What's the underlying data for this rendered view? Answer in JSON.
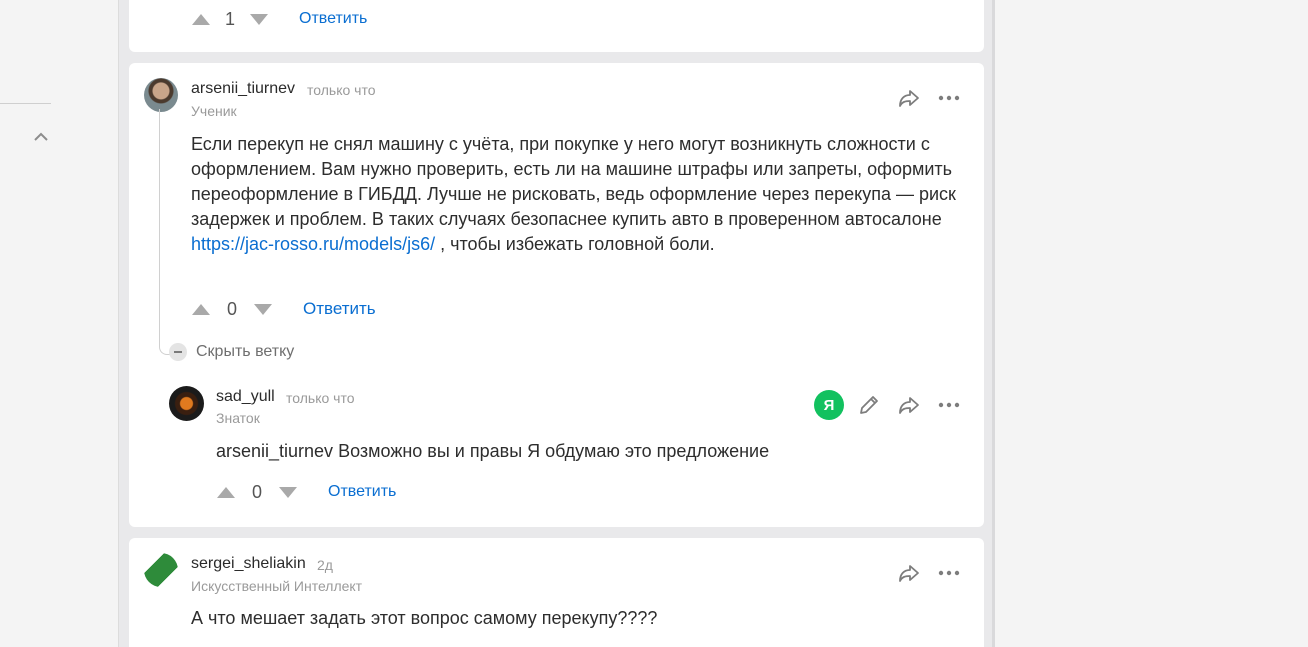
{
  "prev_comment": {
    "vote_count": "1",
    "reply_label": "Ответить"
  },
  "comment_main": {
    "username": "arsenii_tiurnev",
    "time": "только что",
    "rank": "Ученик",
    "text_before_link": "Если перекуп не снял машину с учёта, при покупке у него могут возникнуть сложности с оформлением. Вам нужно проверить, есть ли на машине штрафы или запреты, оформить переоформление в ГИБДД. Лучше не рисковать, ведь оформление через перекупа — риск задержек и проблем. В таких случаях безопаснее купить авто в проверенном автосалоне ",
    "link": "https://jac-rosso.ru/models/js6/",
    "text_after_link": " , чтобы избежать головной боли.",
    "vote_count": "0",
    "reply_label": "Ответить",
    "hide_branch_label": "Скрыть ветку"
  },
  "comment_reply": {
    "username": "sad_yull",
    "time": "только что",
    "rank": "Знаток",
    "text": "arsenii_tiurnev Возможно вы и правы Я обдумаю это предложение",
    "vote_count": "0",
    "reply_label": "Ответить",
    "badge": "Я"
  },
  "comment_next": {
    "username": "sergei_sheliakin",
    "time": "2д",
    "rank": "Искусственный Интеллект",
    "text": "А что мешает задать этот вопрос самому перекупу????"
  },
  "colors": {
    "accent_link": "#0a6ed1",
    "badge_green": "#12c15f",
    "muted_text": "#9a9a9a"
  },
  "icons": [
    "share-icon",
    "more-icon",
    "edit-icon",
    "upvote-icon",
    "downvote-icon",
    "chevron-up-icon",
    "minus-icon"
  ]
}
